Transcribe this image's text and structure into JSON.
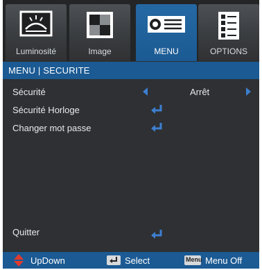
{
  "tabs": [
    {
      "label": "Luminosité",
      "icon": "brightness-icon",
      "active": false
    },
    {
      "label": "Image",
      "icon": "image-icon",
      "active": false
    },
    {
      "label": "MENU",
      "icon": "projector-icon",
      "active": true
    },
    {
      "label": "OPTIONS",
      "icon": "options-icon",
      "active": false
    }
  ],
  "title": "MENU | SECURITE",
  "rows": [
    {
      "label": "Sécurité",
      "value": "Arrêt"
    },
    {
      "label": "Sécurité Horloge"
    },
    {
      "label": "Changer mot passe"
    }
  ],
  "quit_label": "Quitter",
  "footer": {
    "updown": "UpDown",
    "select": "Select",
    "menu_key": "Menu",
    "menu_off": "Menu Off"
  },
  "colors": {
    "accent_blue": "#1b5a93",
    "arrow_blue": "#3d7fd0",
    "panel": "#2e3033"
  }
}
